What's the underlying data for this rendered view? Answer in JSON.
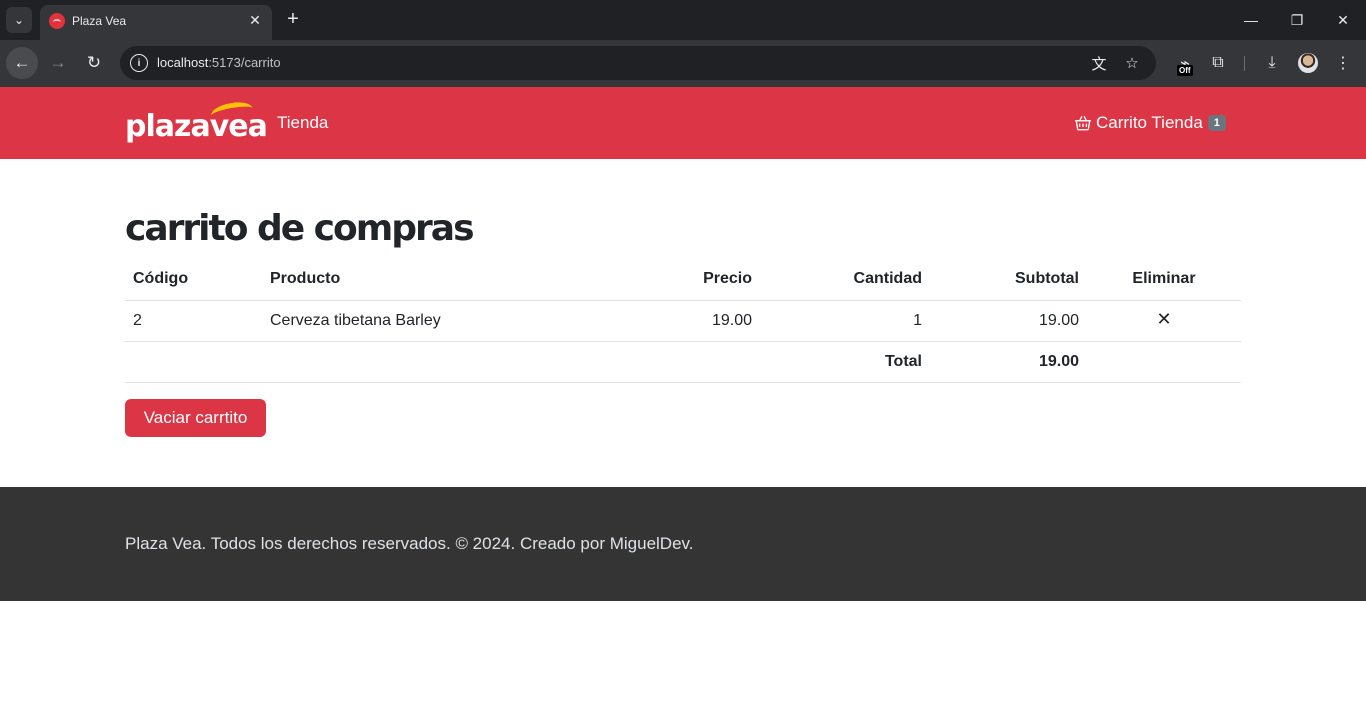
{
  "browser": {
    "tab_title": "Plaza Vea",
    "url_host": "localhost",
    "url_path": ":5173/carrito",
    "extension_badge": "Off"
  },
  "header": {
    "logo_text": "plazavea",
    "nav_store": "Tienda",
    "cart_label": "Carrito Tienda",
    "cart_count": "1",
    "brand_color": "#dc3545",
    "logo_accent": "#ffc107"
  },
  "main": {
    "title": "carrito de compras",
    "columns": {
      "code": "Código",
      "product": "Producto",
      "price": "Precio",
      "quantity": "Cantidad",
      "subtotal": "Subtotal",
      "delete": "Eliminar"
    },
    "rows": [
      {
        "code": "2",
        "product": "Cerveza tibetana Barley",
        "price": "19.00",
        "quantity": "1",
        "subtotal": "19.00",
        "delete_icon": "close-icon"
      }
    ],
    "total_label": "Total",
    "total_value": "19.00",
    "empty_button": "Vaciar carrtito"
  },
  "footer": {
    "text": "Plaza Vea. Todos los derechos reservados. © 2024. Creado por MiguelDev."
  }
}
